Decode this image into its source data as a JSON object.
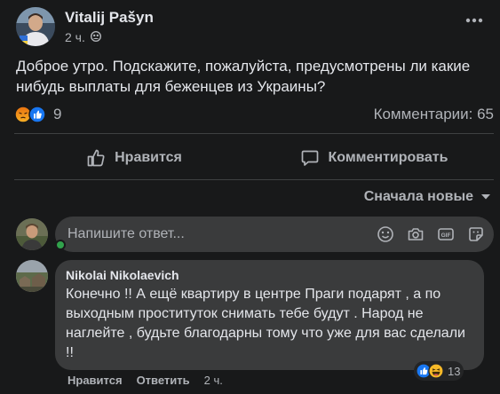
{
  "post": {
    "author": "Vitalij Pašyn",
    "time": "2 ч.",
    "privacy_icon": "friends-icon",
    "text": "Доброе утро. Подскажите, пожалуйста, предусмотрены ли какие нибудь выплаты для беженцев из Украины?",
    "reaction_icons": [
      "angry-icon",
      "like-icon"
    ],
    "reaction_count": "9",
    "comments_count": "Комментарии: 65"
  },
  "actions": {
    "like_label": "Нравится",
    "comment_label": "Комментировать"
  },
  "sort": {
    "label": "Сначала новые"
  },
  "reply": {
    "placeholder": "Напишите ответ..."
  },
  "comment": {
    "author": "Nikolai Nikolaevich",
    "text": "Конечно !! А ещё квартиру в центре Праги подарят , а по выходным проституток снимать тебе будут . Народ не наглейте , будьте благодарны тому что уже для вас сделали !!",
    "reaction_icons": [
      "like-icon",
      "haha-icon"
    ],
    "reaction_count": "13",
    "like_label": "Нравится",
    "reply_label": "Ответить",
    "time": "2 ч."
  },
  "colors": {
    "background": "#18191a",
    "bubble": "#3a3b3c",
    "text_primary": "#e4e6eb",
    "text_secondary": "#b0b3b8",
    "like_blue": "#1877f2",
    "online_green": "#31a24c"
  }
}
